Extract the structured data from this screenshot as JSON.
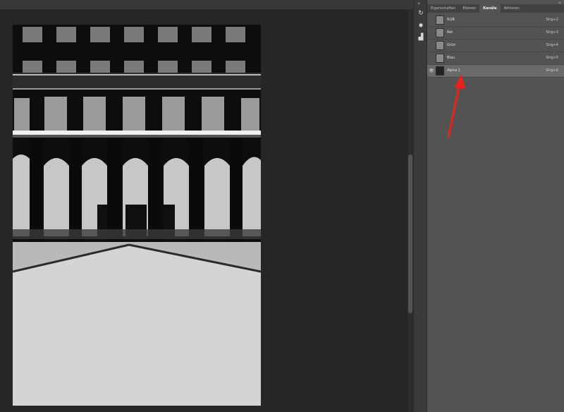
{
  "panel": {
    "collapse_left": "«",
    "collapse_right": "»",
    "tabs": [
      {
        "label": "Eigenschaften",
        "active": false
      },
      {
        "label": "Ebenen",
        "active": false
      },
      {
        "label": "Kanäle",
        "active": true
      },
      {
        "label": "Aktionen",
        "active": false
      }
    ],
    "channels": [
      {
        "name": "RGB",
        "shortcut": "Strg+2",
        "visible": false,
        "selected": false
      },
      {
        "name": "Rot",
        "shortcut": "Strg+3",
        "visible": false,
        "selected": false
      },
      {
        "name": "Grün",
        "shortcut": "Strg+4",
        "visible": false,
        "selected": false
      },
      {
        "name": "Blau",
        "shortcut": "Strg+5",
        "visible": false,
        "selected": false
      },
      {
        "name": "Alpha 1",
        "shortcut": "Strg+6",
        "visible": true,
        "selected": true
      }
    ]
  },
  "icons": {
    "eye": "👁",
    "tool_1": "↻",
    "tool_2": "✸",
    "tool_3": "▟"
  },
  "colors": {
    "arrow": "#e8231e",
    "selected_row": "#6a6a6a"
  }
}
